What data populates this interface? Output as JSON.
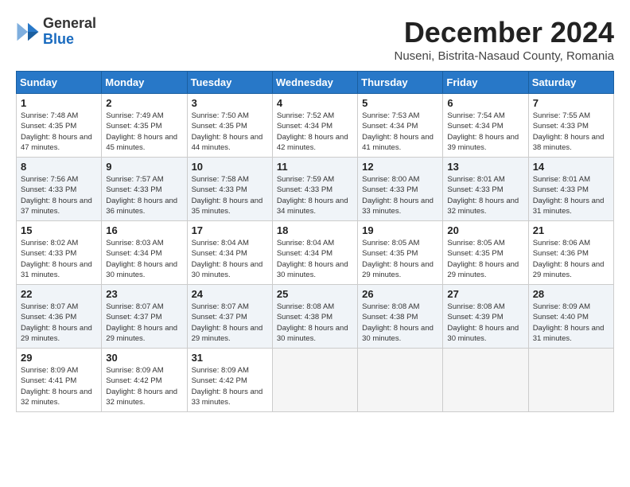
{
  "header": {
    "logo_general": "General",
    "logo_blue": "Blue",
    "month_title": "December 2024",
    "location": "Nuseni, Bistrita-Nasaud County, Romania"
  },
  "weekdays": [
    "Sunday",
    "Monday",
    "Tuesday",
    "Wednesday",
    "Thursday",
    "Friday",
    "Saturday"
  ],
  "weeks": [
    [
      {
        "day": "1",
        "sunrise": "7:48 AM",
        "sunset": "4:35 PM",
        "daylight": "8 hours and 47 minutes."
      },
      {
        "day": "2",
        "sunrise": "7:49 AM",
        "sunset": "4:35 PM",
        "daylight": "8 hours and 45 minutes."
      },
      {
        "day": "3",
        "sunrise": "7:50 AM",
        "sunset": "4:35 PM",
        "daylight": "8 hours and 44 minutes."
      },
      {
        "day": "4",
        "sunrise": "7:52 AM",
        "sunset": "4:34 PM",
        "daylight": "8 hours and 42 minutes."
      },
      {
        "day": "5",
        "sunrise": "7:53 AM",
        "sunset": "4:34 PM",
        "daylight": "8 hours and 41 minutes."
      },
      {
        "day": "6",
        "sunrise": "7:54 AM",
        "sunset": "4:34 PM",
        "daylight": "8 hours and 39 minutes."
      },
      {
        "day": "7",
        "sunrise": "7:55 AM",
        "sunset": "4:33 PM",
        "daylight": "8 hours and 38 minutes."
      }
    ],
    [
      {
        "day": "8",
        "sunrise": "7:56 AM",
        "sunset": "4:33 PM",
        "daylight": "8 hours and 37 minutes."
      },
      {
        "day": "9",
        "sunrise": "7:57 AM",
        "sunset": "4:33 PM",
        "daylight": "8 hours and 36 minutes."
      },
      {
        "day": "10",
        "sunrise": "7:58 AM",
        "sunset": "4:33 PM",
        "daylight": "8 hours and 35 minutes."
      },
      {
        "day": "11",
        "sunrise": "7:59 AM",
        "sunset": "4:33 PM",
        "daylight": "8 hours and 34 minutes."
      },
      {
        "day": "12",
        "sunrise": "8:00 AM",
        "sunset": "4:33 PM",
        "daylight": "8 hours and 33 minutes."
      },
      {
        "day": "13",
        "sunrise": "8:01 AM",
        "sunset": "4:33 PM",
        "daylight": "8 hours and 32 minutes."
      },
      {
        "day": "14",
        "sunrise": "8:01 AM",
        "sunset": "4:33 PM",
        "daylight": "8 hours and 31 minutes."
      }
    ],
    [
      {
        "day": "15",
        "sunrise": "8:02 AM",
        "sunset": "4:33 PM",
        "daylight": "8 hours and 31 minutes."
      },
      {
        "day": "16",
        "sunrise": "8:03 AM",
        "sunset": "4:34 PM",
        "daylight": "8 hours and 30 minutes."
      },
      {
        "day": "17",
        "sunrise": "8:04 AM",
        "sunset": "4:34 PM",
        "daylight": "8 hours and 30 minutes."
      },
      {
        "day": "18",
        "sunrise": "8:04 AM",
        "sunset": "4:34 PM",
        "daylight": "8 hours and 30 minutes."
      },
      {
        "day": "19",
        "sunrise": "8:05 AM",
        "sunset": "4:35 PM",
        "daylight": "8 hours and 29 minutes."
      },
      {
        "day": "20",
        "sunrise": "8:05 AM",
        "sunset": "4:35 PM",
        "daylight": "8 hours and 29 minutes."
      },
      {
        "day": "21",
        "sunrise": "8:06 AM",
        "sunset": "4:36 PM",
        "daylight": "8 hours and 29 minutes."
      }
    ],
    [
      {
        "day": "22",
        "sunrise": "8:07 AM",
        "sunset": "4:36 PM",
        "daylight": "8 hours and 29 minutes."
      },
      {
        "day": "23",
        "sunrise": "8:07 AM",
        "sunset": "4:37 PM",
        "daylight": "8 hours and 29 minutes."
      },
      {
        "day": "24",
        "sunrise": "8:07 AM",
        "sunset": "4:37 PM",
        "daylight": "8 hours and 29 minutes."
      },
      {
        "day": "25",
        "sunrise": "8:08 AM",
        "sunset": "4:38 PM",
        "daylight": "8 hours and 30 minutes."
      },
      {
        "day": "26",
        "sunrise": "8:08 AM",
        "sunset": "4:38 PM",
        "daylight": "8 hours and 30 minutes."
      },
      {
        "day": "27",
        "sunrise": "8:08 AM",
        "sunset": "4:39 PM",
        "daylight": "8 hours and 30 minutes."
      },
      {
        "day": "28",
        "sunrise": "8:09 AM",
        "sunset": "4:40 PM",
        "daylight": "8 hours and 31 minutes."
      }
    ],
    [
      {
        "day": "29",
        "sunrise": "8:09 AM",
        "sunset": "4:41 PM",
        "daylight": "8 hours and 32 minutes."
      },
      {
        "day": "30",
        "sunrise": "8:09 AM",
        "sunset": "4:42 PM",
        "daylight": "8 hours and 32 minutes."
      },
      {
        "day": "31",
        "sunrise": "8:09 AM",
        "sunset": "4:42 PM",
        "daylight": "8 hours and 33 minutes."
      },
      null,
      null,
      null,
      null
    ]
  ]
}
